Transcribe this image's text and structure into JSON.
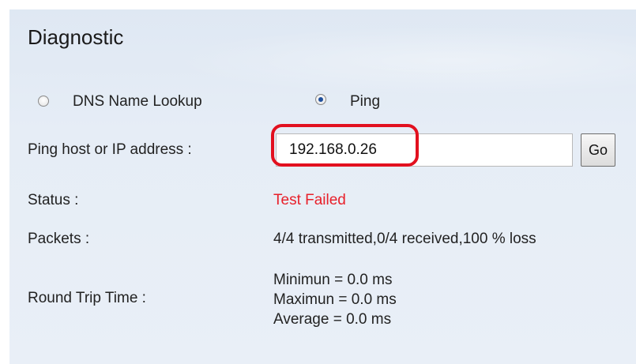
{
  "title": "Diagnostic",
  "mode": {
    "options": [
      {
        "label": "DNS Name Lookup",
        "selected": false
      },
      {
        "label": "Ping",
        "selected": true
      }
    ]
  },
  "ping_host": {
    "label": "Ping host or IP address :",
    "value": "192.168.0.26",
    "go_label": "Go"
  },
  "status": {
    "label": "Status :",
    "value": "Test Failed",
    "color": "#e8202a"
  },
  "packets": {
    "label": "Packets :",
    "value": "4/4 transmitted,0/4 received,100 % loss"
  },
  "rtt": {
    "label": "Round Trip Time :",
    "minimum": "Minimun = 0.0 ms",
    "maximum": "Maximun = 0.0 ms",
    "average": "Average = 0.0 ms"
  },
  "colors": {
    "panel_background": "#e6edf6",
    "highlight": "#e2101f",
    "radio_checked": "#1f4f9c"
  }
}
